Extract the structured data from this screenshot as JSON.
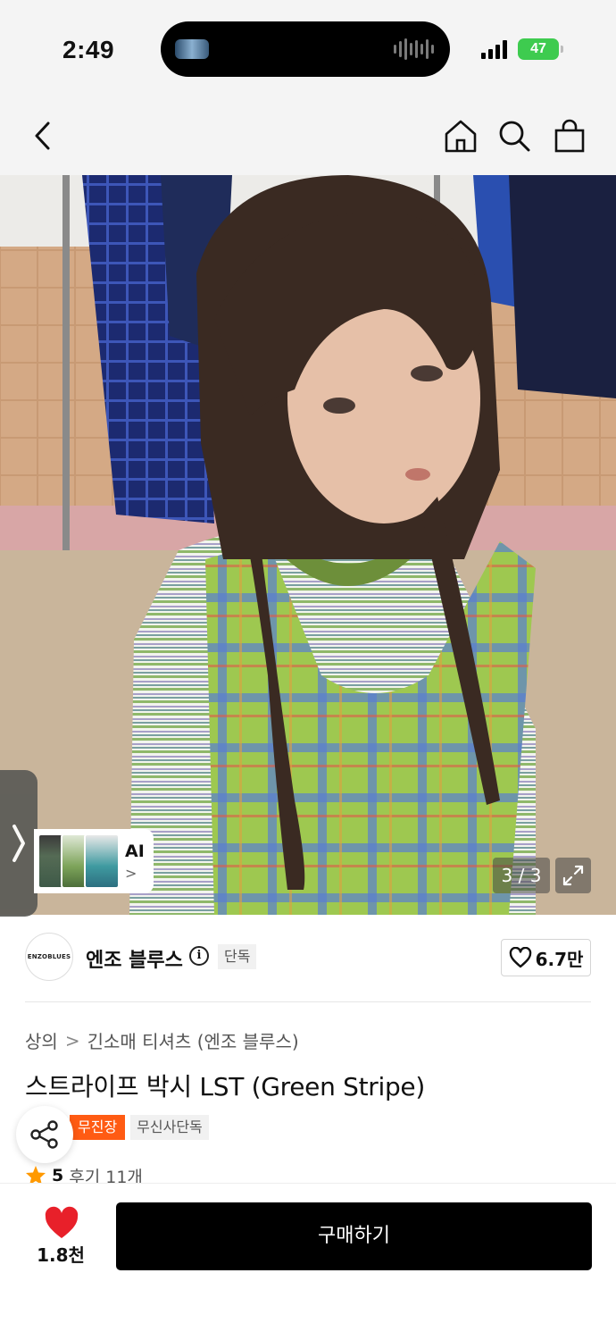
{
  "status_bar": {
    "time": "2:49",
    "battery": "47"
  },
  "nav": {
    "back_icon": "chevron-left",
    "home_icon": "home",
    "search_icon": "search",
    "cart_icon": "shopping-bag"
  },
  "gallery": {
    "counter": "3 / 3",
    "ai_label": "AI",
    "ai_chevron": ">"
  },
  "brand": {
    "logo_text": "ENZOBLUES",
    "name": "엔조 블루스",
    "exclusive": "단독",
    "likes": "6.7만"
  },
  "breadcrumb": {
    "category": "상의",
    "separator": ">",
    "subcategory": "긴소매 티셔츠 (엔조 블루스)"
  },
  "product": {
    "title": "스트라이프 박시 LST (Green Stripe)",
    "tags": [
      "무진장",
      "무신사단독"
    ],
    "rating": "5",
    "reviews": "후기 11개"
  },
  "bottom_bar": {
    "wish_count": "1.8천",
    "buy_label": "구매하기"
  },
  "colors": {
    "accent_orange": "#ff5b13",
    "heart_red": "#e8202a",
    "battery_green": "#3ecb4f",
    "star": "#ff9900"
  }
}
